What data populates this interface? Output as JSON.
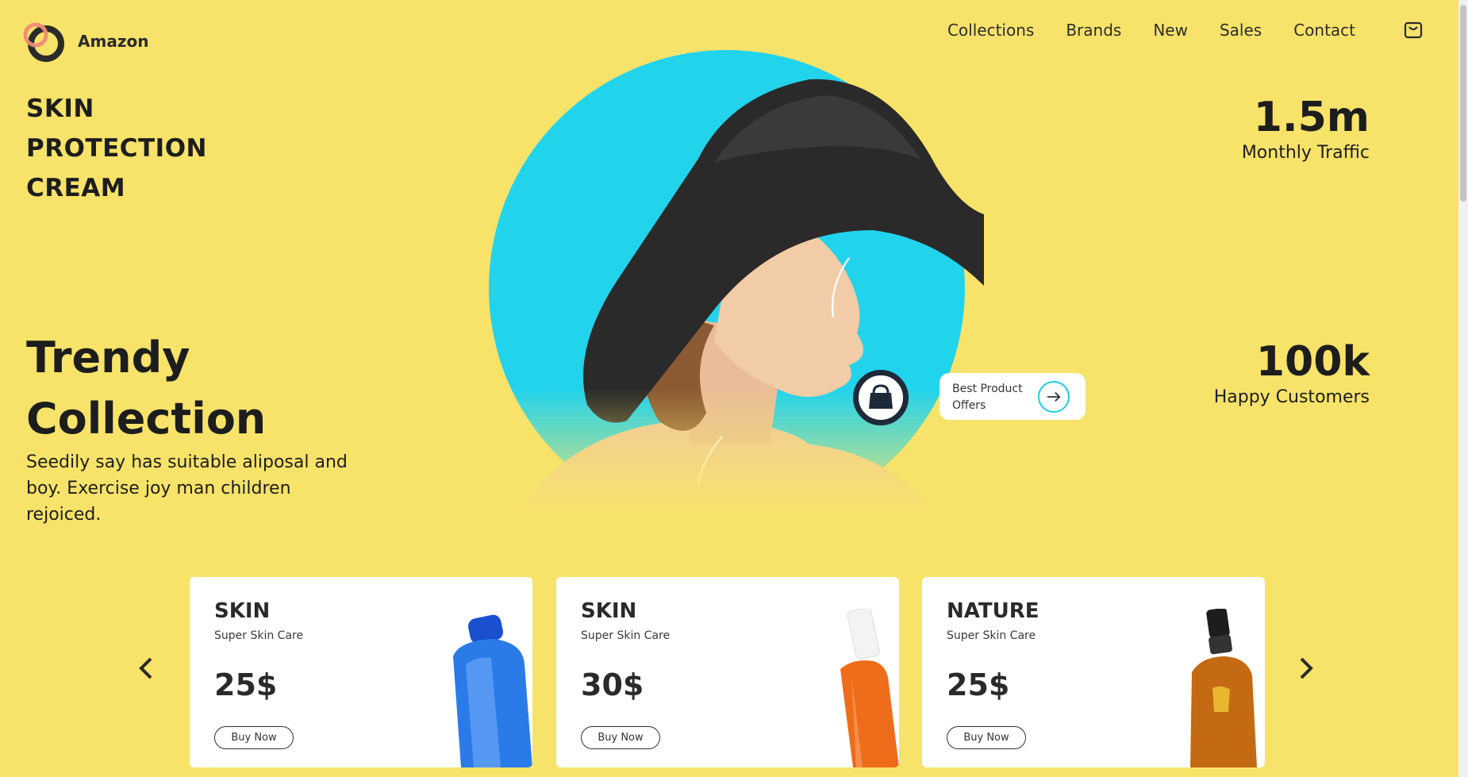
{
  "brand": {
    "name": "Amazon",
    "logo_icon": "ring-logo-icon"
  },
  "nav": {
    "items": [
      "Collections",
      "Brands",
      "New",
      "Sales",
      "Contact"
    ],
    "cart_icon": "shopping-bag-icon"
  },
  "hero": {
    "skin_title": "SKIN\nPROTECTION\nCREAM",
    "trendy_title": "Trendy\nCollection",
    "description": "Seedily say has suitable aliposal and boy. Exercise joy man children rejoiced.",
    "offer_label": "Best Product\nOffers"
  },
  "stats": [
    {
      "value": "1.5m",
      "label": "Monthly Traffic"
    },
    {
      "value": "100k",
      "label": "Happy Customers"
    }
  ],
  "cards": [
    {
      "category": "SKIN",
      "subtitle": "Super Skin Care",
      "price": "25$",
      "button": "Buy Now",
      "product": "blue-bottle"
    },
    {
      "category": "SKIN",
      "subtitle": "Super Skin Care",
      "price": "30$",
      "button": "Buy Now",
      "product": "orange-spray"
    },
    {
      "category": "NATURE",
      "subtitle": "Super Skin Care",
      "price": "25$",
      "button": "Buy Now",
      "product": "amber-spray"
    }
  ],
  "colors": {
    "background": "#f8e36a",
    "accent": "#20cbe6",
    "logo_ring": "#2b2b2b",
    "logo_ring_2": "#f08a78"
  }
}
